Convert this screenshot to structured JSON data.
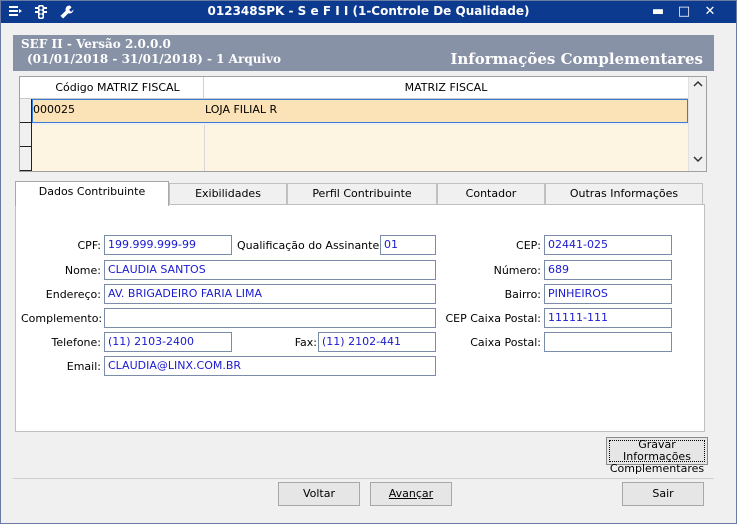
{
  "window": {
    "title": "012348SPK - S e F  I I (1-Controle De Qualidade)",
    "icons": [
      "menu-icon",
      "traffic-light-icon",
      "wrench-icon"
    ],
    "controls": {
      "minimize": "▬",
      "maximize": "□",
      "close": "✕"
    }
  },
  "header": {
    "line1": "SEF II - Versão 2.0.0.0",
    "line2": "(01/01/2018 - 31/01/2018) - 1 Arquivo",
    "section_title": "Informações Complementares"
  },
  "grid": {
    "columns": [
      "Código MATRIZ FISCAL",
      "MATRIZ FISCAL"
    ],
    "rows": [
      {
        "codigo": "000025",
        "nome": "LOJA FILIAL R"
      }
    ]
  },
  "tabs": [
    {
      "label": "Dados Contribuinte",
      "active": true
    },
    {
      "label": "Exibilidades",
      "active": false
    },
    {
      "label": "Perfil Contribuinte",
      "active": false
    },
    {
      "label": "Contador",
      "active": false
    },
    {
      "label": "Outras Informações",
      "active": false
    }
  ],
  "form": {
    "cpf": {
      "label": "CPF:",
      "value": "199.999.999-99"
    },
    "qualificacao": {
      "label": "Qualificação do Assinante:",
      "value": "01"
    },
    "cep": {
      "label": "CEP:",
      "value": "02441-025"
    },
    "nome": {
      "label": "Nome:",
      "value": "CLAUDIA SANTOS"
    },
    "numero": {
      "label": "Número:",
      "value": "689"
    },
    "endereco": {
      "label": "Endereço:",
      "value": "AV. BRIGADEIRO FARIA LIMA"
    },
    "bairro": {
      "label": "Bairro:",
      "value": "PINHEIROS"
    },
    "complemento": {
      "label": "Complemento:",
      "value": ""
    },
    "cep_caixa_postal": {
      "label": "CEP Caixa Postal:",
      "value": "11111-111"
    },
    "telefone": {
      "label": "Telefone:",
      "value": "(11) 2103-2400"
    },
    "fax": {
      "label": "Fax:",
      "value": "(11) 2102-441"
    },
    "caixa_postal": {
      "label": "Caixa Postal:",
      "value": ""
    },
    "email": {
      "label": "Email:",
      "value": "CLAUDIA@LINX.COM.BR"
    }
  },
  "buttons": {
    "gravar_line1": "Gravar Informações",
    "gravar_line2": "Complementares",
    "voltar": "Voltar",
    "avancar": "Avançar",
    "sair": "Sair"
  },
  "colors": {
    "titlebar": "#0b3a8f",
    "header_band": "#8892a6",
    "selected_row": "#fbe3b7",
    "field_text": "#1a1ad0"
  }
}
